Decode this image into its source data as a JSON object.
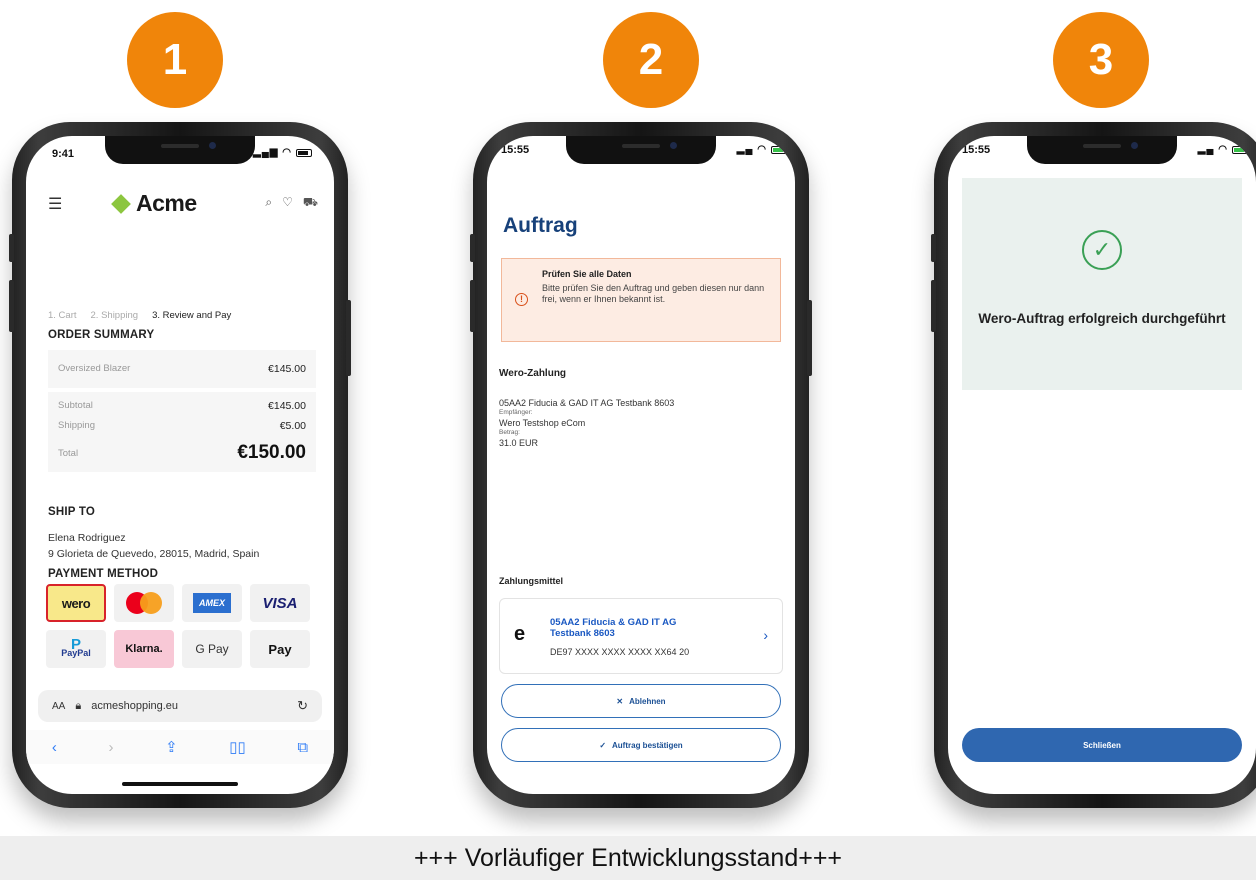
{
  "badges": [
    "1",
    "2",
    "3"
  ],
  "phone1": {
    "status_time": "9:41",
    "brand": "Acme",
    "steps": [
      "1. Cart",
      "2. Shipping",
      "3. Review and Pay"
    ],
    "order_summary_title": "ORDER SUMMARY",
    "item_name": "Oversized Blazer",
    "item_price": "€145.00",
    "subtotal_label": "Subtotal",
    "subtotal_value": "€145.00",
    "shipping_label": "Shipping",
    "shipping_value": "€5.00",
    "total_label": "Total",
    "total_value": "€150.00",
    "ship_to_title": "SHIP TO",
    "ship_name": "Elena Rodriguez",
    "ship_address": "9 Glorieta de Quevedo, 28015, Madrid, Spain",
    "payment_title": "PAYMENT METHOD",
    "payments": {
      "wero": "wero",
      "amex": "AMEX",
      "visa": "VISA",
      "paypal_word": "PayPal",
      "klarna": "Klarna.",
      "gpay": "G Pay",
      "apay": " Pay"
    },
    "url_aa": "AA",
    "url": "acmeshopping.eu"
  },
  "phone2": {
    "status_time": "15:55",
    "title": "Auftrag",
    "alert_title": "Prüfen Sie alle Daten",
    "alert_body": "Bitte prüfen Sie den Auftrag und geben diesen nur dann frei, wenn er Ihnen bekannt ist.",
    "payment_title": "Wero-Zahlung",
    "bank_line": "05AA2 Fiducia & GAD IT AG Testbank 8603",
    "recipient_label": "Empfänger:",
    "recipient": "Wero Testshop eCom",
    "amount_label": "Betrag:",
    "amount": "31.0 EUR",
    "means_title": "Zahlungsmittel",
    "card_name": "05AA2 Fiducia & GAD IT AG Testbank 8603",
    "card_iban": "DE97 XXXX XXXX XXXX XX64 20",
    "reject_label": "Ablehnen",
    "confirm_label": "Auftrag bestätigen"
  },
  "phone3": {
    "status_time": "15:55",
    "message": "Wero-Auftrag erfolgreich durchgeführt",
    "close_label": "Schließen"
  },
  "footer": "+++ Vorläufiger Entwicklungsstand+++",
  "colors": {
    "badge": "#f0850a",
    "bank_blue": "#17417a",
    "success_green": "#3aa055",
    "button_blue": "#2f67b0"
  }
}
